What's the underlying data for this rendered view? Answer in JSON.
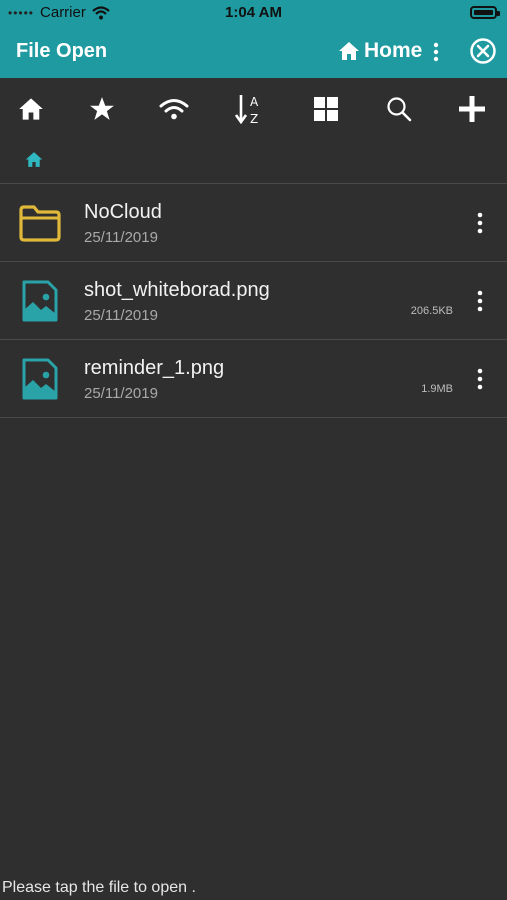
{
  "status_bar": {
    "carrier": "Carrier",
    "time": "1:04 AM"
  },
  "app_bar": {
    "title": "File Open",
    "location": "Home"
  },
  "toolbar": {
    "icons": [
      "home-icon",
      "star-icon",
      "wifi-icon",
      "sort-az-icon",
      "grid-icon",
      "search-icon",
      "plus-icon"
    ]
  },
  "files": [
    {
      "name": "NoCloud",
      "date": "25/11/2019",
      "size": "",
      "type": "folder"
    },
    {
      "name": "shot_whiteborad.png",
      "date": "25/11/2019",
      "size": "206.5KB",
      "type": "image"
    },
    {
      "name": "reminder_1.png",
      "date": "25/11/2019",
      "size": "1.9MB",
      "type": "image"
    }
  ],
  "footer": {
    "hint": "Please tap the file to open ."
  },
  "colors": {
    "accent": "#1e9aa0",
    "background": "#2f2f2f",
    "folder": "#e0b93a",
    "image_icon": "#2aa3a8"
  }
}
